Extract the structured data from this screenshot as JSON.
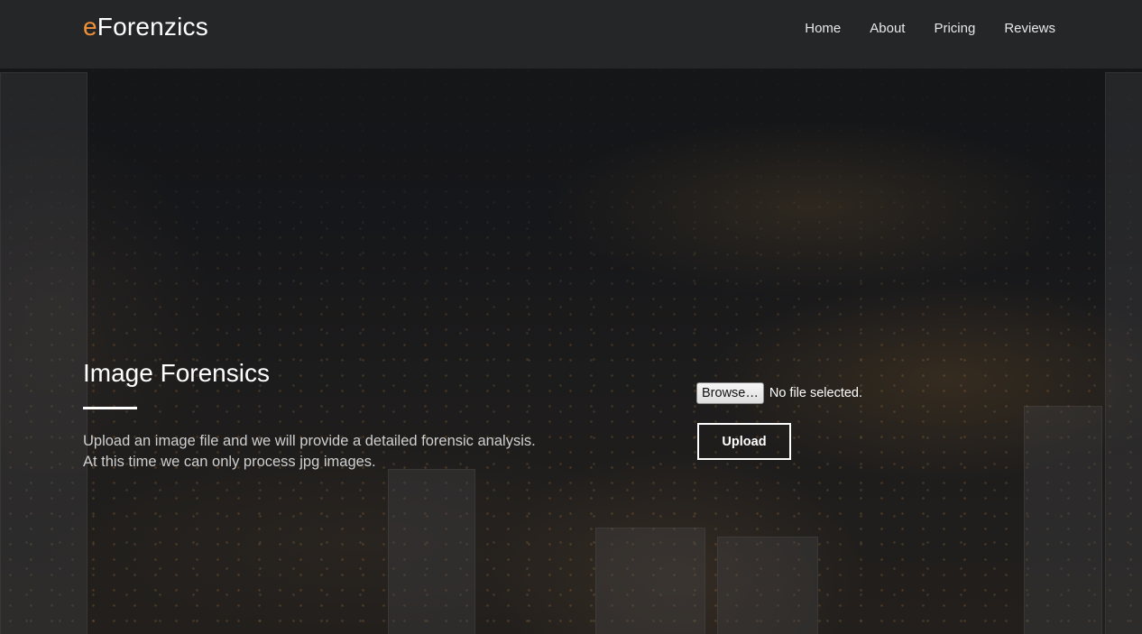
{
  "brand": {
    "prefix": "e",
    "name": "Forenzics",
    "accent_color": "#f0913a"
  },
  "nav": {
    "items": [
      {
        "label": "Home"
      },
      {
        "label": "About"
      },
      {
        "label": "Pricing"
      },
      {
        "label": "Reviews"
      }
    ]
  },
  "hero": {
    "title": "Image Forensics",
    "description_line1": "Upload an image file and we will provide a detailed forensic analysis.",
    "description_line2": "At this time we can only process jpg images."
  },
  "upload_form": {
    "browse_label": "Browse…",
    "file_status": "No file selected.",
    "upload_label": "Upload"
  }
}
